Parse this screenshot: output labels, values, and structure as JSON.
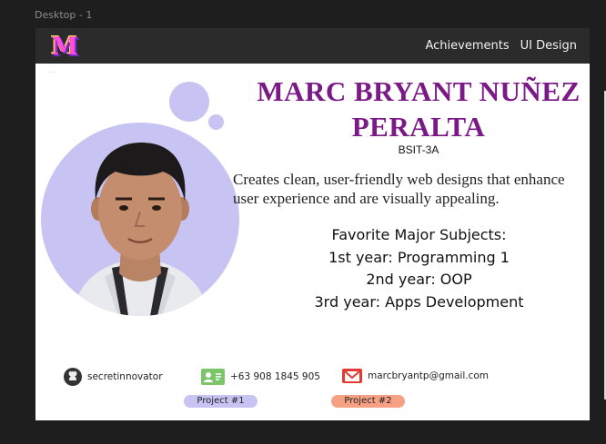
{
  "canvas": {
    "frame_label": "Desktop - 1"
  },
  "navbar": {
    "logo_letter": "M",
    "links": [
      "Achievements",
      "UI Design"
    ]
  },
  "decor": {
    "dots": "- - -"
  },
  "profile": {
    "name": "MARC BRYANT NUÑEZ PERALTA",
    "section": "BSIT-3A",
    "tagline_line1": "Creates clean, user-friendly web designs that enhance",
    "tagline_line2": "user experience and are visually appealing."
  },
  "subjects": {
    "heading": "Favorite Major Subjects:",
    "items": [
      "1st year: Programming 1",
      "2nd year: OOP",
      "3rd year: Apps Development"
    ]
  },
  "contacts": {
    "github": "secretinnovator",
    "phone": "+63 908 1845 905",
    "email": "marcbryantp@gmail.com"
  },
  "projects": [
    "Project  #1",
    "Project #2"
  ],
  "colors": {
    "background": "#1e1e1e",
    "navbar": "#2b2b2b",
    "name": "#7b1a86",
    "lavender": "#c7c3f3",
    "project2": "#f7a184",
    "email_icon": "#e53935",
    "phone_icon": "#7cc56b"
  }
}
